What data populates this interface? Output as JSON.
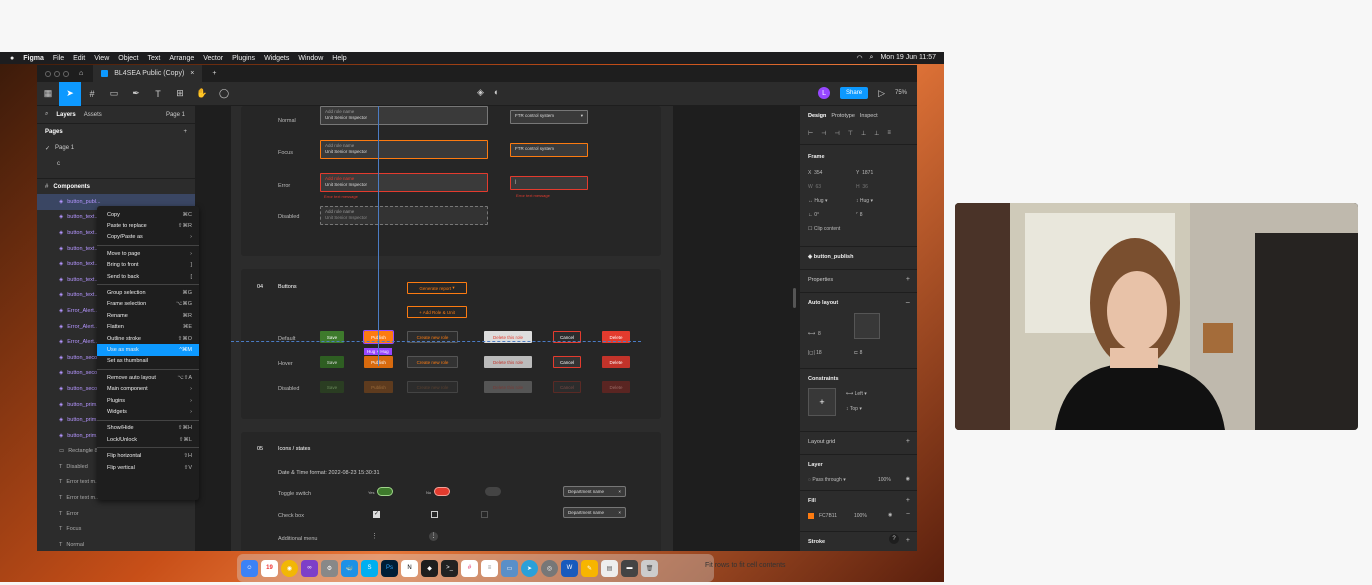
{
  "menubar": {
    "app": "Figma",
    "items": [
      "File",
      "Edit",
      "View",
      "Object",
      "Text",
      "Arrange",
      "Vector",
      "Plugins",
      "Widgets",
      "Window",
      "Help"
    ],
    "clock": "Mon 19 Jun 11:57"
  },
  "tab": {
    "home_icon": "home-icon",
    "title": "BL4SEA Public (Copy)",
    "close": "×",
    "add": "+"
  },
  "toolbar": {
    "zoom": "75%",
    "share": "Share",
    "avatar": "L"
  },
  "left": {
    "tabs": [
      "Layers",
      "Assets"
    ],
    "page_selector": "Page 1",
    "pages_title": "Pages",
    "pages": [
      "Page 1",
      "c"
    ],
    "components_title": "Components",
    "layers": [
      {
        "name": "button_publ...",
        "type": "comp",
        "sel": true
      },
      {
        "name": "button_text...",
        "type": "comp"
      },
      {
        "name": "button_text...",
        "type": "comp"
      },
      {
        "name": "button_text...",
        "type": "comp"
      },
      {
        "name": "button_text...",
        "type": "comp"
      },
      {
        "name": "button_text...",
        "type": "comp"
      },
      {
        "name": "button_text...",
        "type": "comp"
      },
      {
        "name": "Error_Alert...",
        "type": "comp"
      },
      {
        "name": "Error_Alert...",
        "type": "comp"
      },
      {
        "name": "Error_Alert...",
        "type": "comp"
      },
      {
        "name": "button_seco...",
        "type": "comp"
      },
      {
        "name": "button_seco...",
        "type": "comp"
      },
      {
        "name": "button_seco...",
        "type": "comp"
      },
      {
        "name": "button_prim...",
        "type": "comp"
      },
      {
        "name": "button_prim...",
        "type": "comp"
      },
      {
        "name": "button_prim...",
        "type": "comp"
      },
      {
        "name": "Rectangle 8",
        "type": "rect"
      },
      {
        "name": "Disabled",
        "type": "text"
      },
      {
        "name": "Error text m...",
        "type": "text"
      },
      {
        "name": "Error text m...",
        "type": "text"
      },
      {
        "name": "Error",
        "type": "text"
      },
      {
        "name": "Focus",
        "type": "text"
      },
      {
        "name": "Normal",
        "type": "text"
      },
      {
        "name": "Default",
        "type": "text"
      }
    ]
  },
  "context_menu": [
    {
      "label": "Copy",
      "key": "⌘C"
    },
    {
      "label": "Paste to replace",
      "key": "⇧⌘R"
    },
    {
      "label": "Copy/Paste as",
      "key": "›"
    },
    {
      "sep": true
    },
    {
      "label": "Move to page",
      "key": "›"
    },
    {
      "label": "Bring to front",
      "key": "]"
    },
    {
      "label": "Send to back",
      "key": "["
    },
    {
      "sep": true
    },
    {
      "label": "Group selection",
      "key": "⌘G"
    },
    {
      "label": "Frame selection",
      "key": "⌥⌘G"
    },
    {
      "label": "Rename",
      "key": "⌘R"
    },
    {
      "label": "Flatten",
      "key": "⌘E"
    },
    {
      "label": "Outline stroke",
      "key": "⇧⌘O"
    },
    {
      "label": "Use as mask",
      "key": "^⌘M",
      "hl": true
    },
    {
      "label": "Set as thumbnail",
      "key": ""
    },
    {
      "sep": true
    },
    {
      "label": "Remove auto layout",
      "key": "⌥⇧A"
    },
    {
      "label": "Main component",
      "key": "›"
    },
    {
      "label": "Plugins",
      "key": "›"
    },
    {
      "label": "Widgets",
      "key": "›"
    },
    {
      "sep": true
    },
    {
      "label": "Show/Hide",
      "key": "⇧⌘H"
    },
    {
      "label": "Lock/Unlock",
      "key": "⇧⌘L"
    },
    {
      "sep": true
    },
    {
      "label": "Flip horizontal",
      "key": "⇧H"
    },
    {
      "label": "Flip vertical",
      "key": "⇧V"
    }
  ],
  "canvas": {
    "states": [
      "Normal",
      "Focus",
      "Error",
      "Disabled"
    ],
    "input_label": "Add role name",
    "input_value": "Unit Senior Inspector",
    "error_msg": "Error text message",
    "dropdown_value": "FTR control system",
    "error_msg2": "Error text message",
    "section04": {
      "num": "04",
      "title": "Buttons",
      "gen": "Generate report",
      "add": "+ Add Role & Unit",
      "hug": "Hug × Hug",
      "rows": [
        "Default",
        "Hover",
        "Disabled"
      ],
      "buttons": [
        "Save",
        "Publish",
        "Create new role",
        "Delete this role",
        "Cancel",
        "Delete"
      ]
    },
    "section05": {
      "num": "05",
      "title": "Icons / states",
      "date": "Date & Time format: 2022-08-23 15:30:31",
      "toggle": "Toggle switch",
      "yes": "Yes",
      "no": "No",
      "checkbox": "Check box",
      "menu": "Additional menu",
      "chip": "Department name",
      "chip_x": "×"
    }
  },
  "right": {
    "tabs": [
      "Design",
      "Prototype",
      "Inspect"
    ],
    "frame": "Frame",
    "x": "354",
    "y": "1871",
    "w": "63",
    "h": "36",
    "hug_w": "Hug",
    "hug_h": "Hug",
    "rot": "0°",
    "radius": "8",
    "clip": "Clip content",
    "component": "button_publish",
    "properties": "Properties",
    "autolayout": "Auto layout",
    "spacing": "8",
    "pad_h": "18",
    "pad_v": "8",
    "constraints": "Constraints",
    "left": "Left",
    "top": "Top",
    "layoutgrid": "Layout grid",
    "layer": "Layer",
    "passthrough": "Pass through",
    "opacity": "100%",
    "fill": "Fill",
    "fillhex": "FC7B11",
    "fillop": "100%",
    "stroke": "Stroke",
    "fill_color": "#FC7B11"
  },
  "dock_tip": "Fit rows to fit cell contents",
  "dock_date": "19",
  "colors": {
    "green": "#3e7a2c",
    "orange": "#fc7b11",
    "red": "#e33b2e",
    "accent": "#0d99ff"
  }
}
